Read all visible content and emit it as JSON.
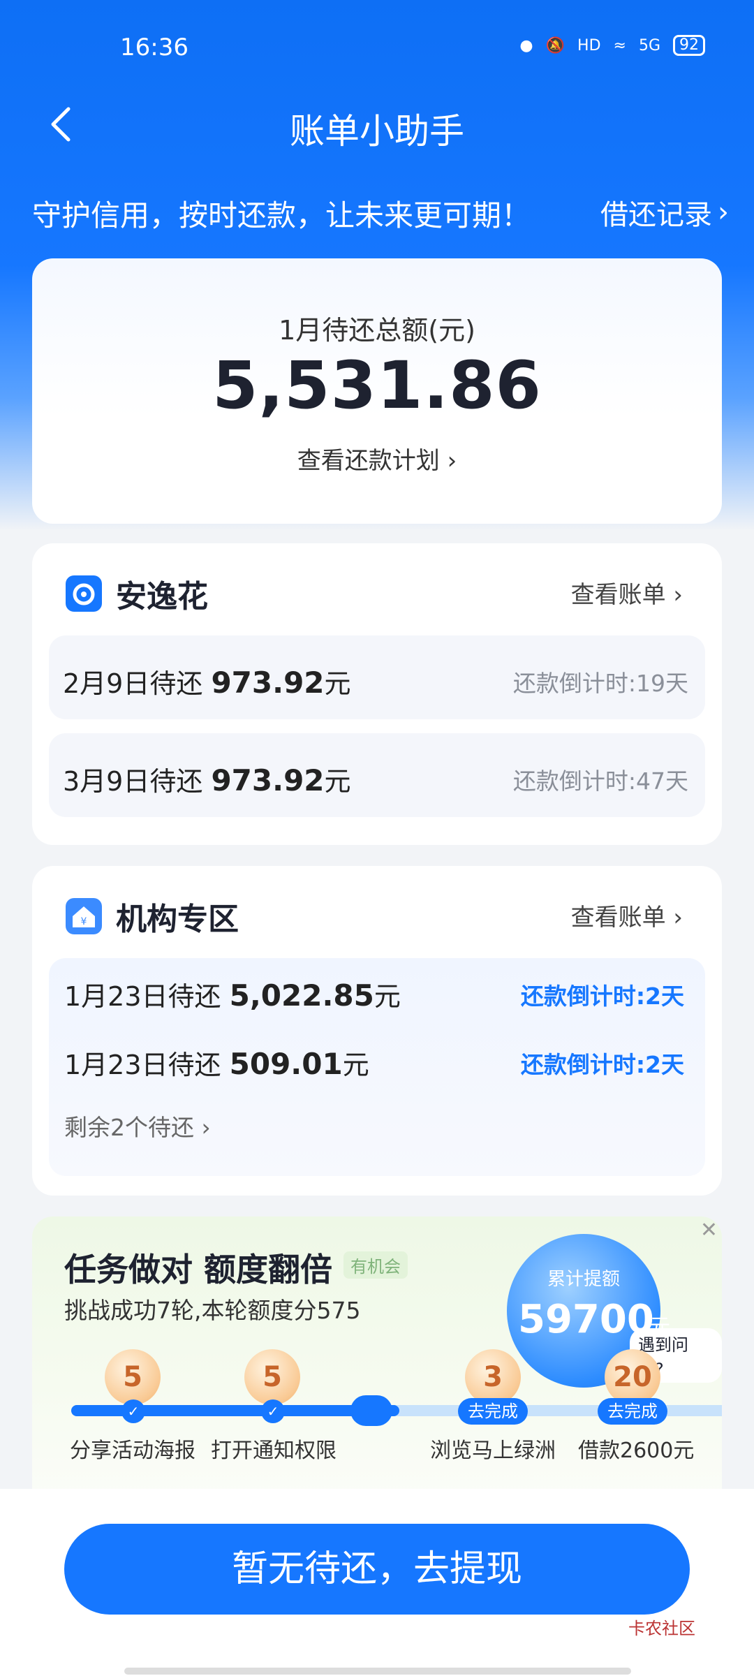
{
  "status": {
    "time": "16:36",
    "battery": "92",
    "network": "5G",
    "hd": "HD"
  },
  "header": {
    "title": "账单小助手",
    "slogan": "守护信用，按时还款，让未来更可期！",
    "records": "借还记录"
  },
  "summary": {
    "label": "1月待还总额(元)",
    "amount": "5,531.86",
    "plan_link": "查看还款计划"
  },
  "anyihua": {
    "title": "安逸花",
    "link": "查看账单",
    "rows": [
      {
        "date": "2月9日待还",
        "amount": "973.92",
        "unit": "元",
        "countdown": "还款倒计时:19天"
      },
      {
        "date": "3月9日待还",
        "amount": "973.92",
        "unit": "元",
        "countdown": "还款倒计时:47天"
      }
    ]
  },
  "institution": {
    "title": "机构专区",
    "link": "查看账单",
    "rows": [
      {
        "date": "1月23日待还",
        "amount": "5,022.85",
        "unit": "元",
        "countdown": "还款倒计时:2天"
      },
      {
        "date": "1月23日待还",
        "amount": "509.01",
        "unit": "元",
        "countdown": "还款倒计时:2天"
      }
    ],
    "remaining": "剩余2个待还"
  },
  "task": {
    "title": "任务做对 额度翻倍",
    "tag": "有机会",
    "subtitle": "挑战成功7轮,本轮额度分575",
    "bubble_label": "累计提额",
    "bubble_value": "59700",
    "bubble_unit": "元",
    "help": "遇到问题?",
    "progress_fraction": 0.5,
    "steps": [
      {
        "value": "5",
        "label": "分享活动海报",
        "done": true
      },
      {
        "value": "5",
        "label": "打开通知权限",
        "done": true
      },
      {
        "value": "3",
        "label": "浏览马上绿洲",
        "action": "去完成"
      },
      {
        "value": "20",
        "label": "借款2600元",
        "action": "去完成"
      }
    ]
  },
  "cta": {
    "label": "暂无待还，去提现"
  },
  "watermark": "卡农社区",
  "colors": {
    "primary": "#1677ff",
    "coin": "#f9c993"
  }
}
